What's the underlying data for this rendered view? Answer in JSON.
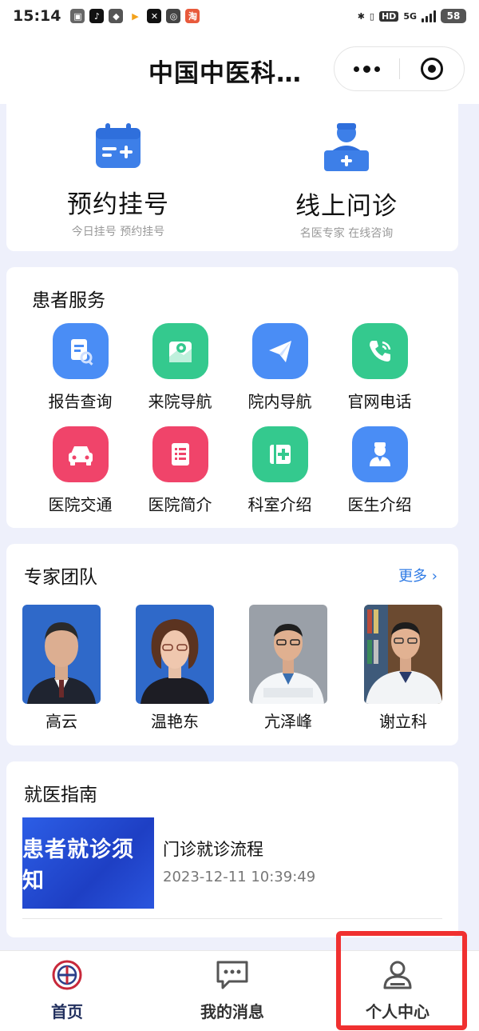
{
  "status_bar": {
    "time": "15:14",
    "network": "5G",
    "hd": "HD",
    "battery": "58"
  },
  "nav": {
    "title": "中国中医科…"
  },
  "top_actions": [
    {
      "label": "预约挂号",
      "sub": "今日挂号 预约挂号",
      "icon": "calendar-plus-icon"
    },
    {
      "label": "线上问诊",
      "sub": "名医专家 在线咨询",
      "icon": "doctor-consult-icon"
    }
  ],
  "services": {
    "title": "患者服务",
    "items": [
      {
        "label": "报告查询",
        "icon": "report-search-icon",
        "color": "#4a8df5"
      },
      {
        "label": "来院导航",
        "icon": "map-pin-icon",
        "color": "#34c98e"
      },
      {
        "label": "院内导航",
        "icon": "paper-plane-icon",
        "color": "#4a8df5"
      },
      {
        "label": "官网电话",
        "icon": "phone-icon",
        "color": "#34c98e"
      },
      {
        "label": "医院交通",
        "icon": "car-icon",
        "color": "#f0446a"
      },
      {
        "label": "医院简介",
        "icon": "document-icon",
        "color": "#f0446a"
      },
      {
        "label": "科室介绍",
        "icon": "department-icon",
        "color": "#34c98e"
      },
      {
        "label": "医生介绍",
        "icon": "doctor-icon",
        "color": "#4a8df5"
      }
    ]
  },
  "experts": {
    "title": "专家团队",
    "more": "更多",
    "items": [
      {
        "name": "高云"
      },
      {
        "name": "温艳东"
      },
      {
        "name": "亢泽峰"
      },
      {
        "name": "谢立科"
      }
    ]
  },
  "guide": {
    "title": "就医指南",
    "thumb_text": "患者就诊须知",
    "item_title": "门诊就诊流程",
    "item_time": "2023-12-11 10:39:49"
  },
  "tabs": [
    {
      "label": "首页",
      "icon": "hospital-logo-icon"
    },
    {
      "label": "我的消息",
      "icon": "message-icon"
    },
    {
      "label": "个人中心",
      "icon": "user-icon"
    }
  ],
  "colors": {
    "accent": "#2f7be5",
    "highlight": "#f03030",
    "page_bg": "#eef0fb"
  }
}
